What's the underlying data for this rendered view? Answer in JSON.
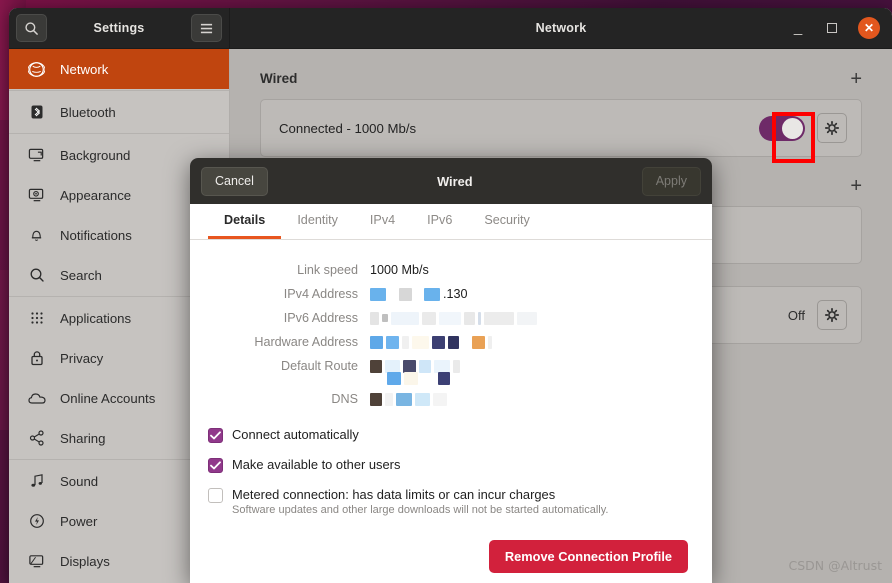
{
  "desktop": {
    "watermark": "CSDN @Altrust"
  },
  "window": {
    "sidebar_header": {
      "title": "Settings",
      "search_icon": "search-icon",
      "menu_icon": "hamburger-menu-icon"
    },
    "title": "Network",
    "controls": {
      "minimize": "minimize-icon",
      "maximize": "maximize-icon",
      "close": "close-icon"
    }
  },
  "sidebar": {
    "items": [
      {
        "label": "Network",
        "icon": "globe-icon",
        "active": true
      },
      {
        "label": "Bluetooth",
        "icon": "bluetooth-icon",
        "active": false
      },
      {
        "label": "Background",
        "icon": "monitor-icon",
        "active": false
      },
      {
        "label": "Appearance",
        "icon": "appearance-icon",
        "active": false
      },
      {
        "label": "Notifications",
        "icon": "bell-icon",
        "active": false
      },
      {
        "label": "Search",
        "icon": "search-icon",
        "active": false
      },
      {
        "label": "Applications",
        "icon": "grid-apps-icon",
        "active": false
      },
      {
        "label": "Privacy",
        "icon": "lock-icon",
        "active": false
      },
      {
        "label": "Online Accounts",
        "icon": "cloud-icon",
        "active": false
      },
      {
        "label": "Sharing",
        "icon": "share-nodes-icon",
        "active": false
      },
      {
        "label": "Sound",
        "icon": "music-note-icon",
        "active": false
      },
      {
        "label": "Power",
        "icon": "power-bolt-icon",
        "active": false
      },
      {
        "label": "Displays",
        "icon": "display-icon",
        "active": false
      }
    ]
  },
  "content": {
    "wired": {
      "section_title": "Wired",
      "add_label": "+",
      "status": "Connected - 1000 Mb/s",
      "toggle_on": true,
      "settings_icon": "gear-icon"
    },
    "second_section": {
      "add_label": "+"
    },
    "third_section": {
      "status": "Off",
      "settings_icon": "gear-icon"
    }
  },
  "dialog": {
    "cancel_label": "Cancel",
    "title": "Wired",
    "apply_label": "Apply",
    "apply_enabled": false,
    "tabs": [
      {
        "label": "Details",
        "active": true
      },
      {
        "label": "Identity",
        "active": false
      },
      {
        "label": "IPv4",
        "active": false
      },
      {
        "label": "IPv6",
        "active": false
      },
      {
        "label": "Security",
        "active": false
      }
    ],
    "details": [
      {
        "label": "Link speed",
        "value": "1000 Mb/s",
        "redacted": false
      },
      {
        "label": "IPv4 Address",
        "value": ".130",
        "redacted": true,
        "highlighted": true
      },
      {
        "label": "IPv6 Address",
        "value": "",
        "redacted": true
      },
      {
        "label": "Hardware Address",
        "value": "",
        "redacted": true
      },
      {
        "label": "Default Route",
        "value": "",
        "redacted": true
      },
      {
        "label": "DNS",
        "value": "",
        "redacted": true
      }
    ],
    "checkboxes": [
      {
        "label": "Connect automatically",
        "checked": true,
        "sub": ""
      },
      {
        "label": "Make available to other users",
        "checked": true,
        "sub": ""
      },
      {
        "label": "Metered connection: has data limits or can incur charges",
        "checked": false,
        "sub": "Software updates and other large downloads will not be started automatically."
      }
    ],
    "remove_label": "Remove Connection Profile"
  },
  "colors": {
    "accent_orange": "#c0450f",
    "tab_underline": "#e8561f",
    "toggle_purple": "#6e2a68",
    "checkbox_purple": "#91398b",
    "danger_red": "#d2213c",
    "highlight_red": "#fe0000",
    "close_button": "#e2571e"
  }
}
